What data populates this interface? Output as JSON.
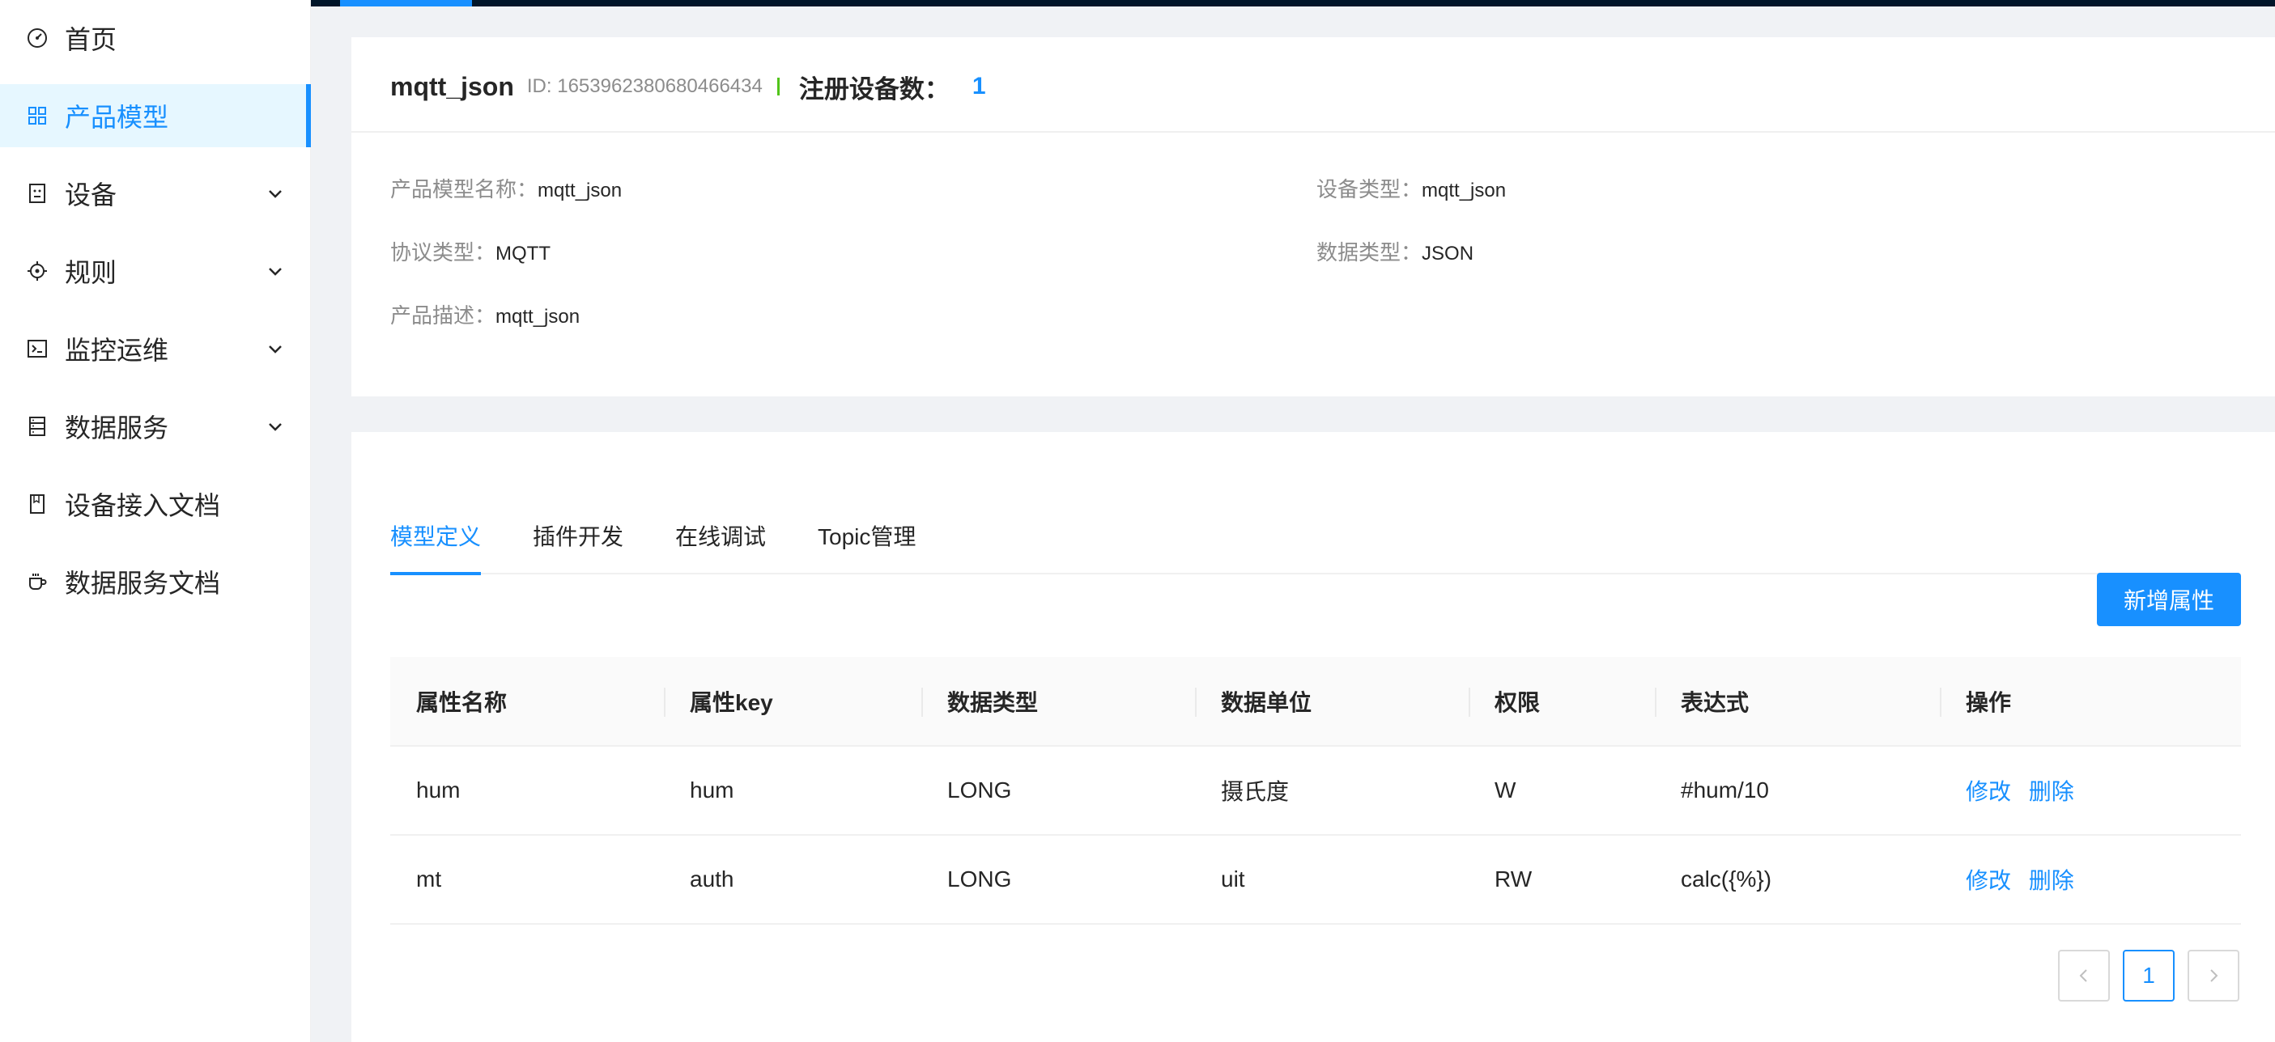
{
  "sidebar": {
    "items": [
      {
        "label": "首页",
        "icon": "dashboard-icon"
      },
      {
        "label": "产品模型",
        "icon": "appstore-icon"
      },
      {
        "label": "设备",
        "icon": "device-icon"
      },
      {
        "label": "规则",
        "icon": "aim-icon"
      },
      {
        "label": "监控运维",
        "icon": "terminal-icon"
      },
      {
        "label": "数据服务",
        "icon": "database-icon"
      },
      {
        "label": "设备接入文档",
        "icon": "book-icon"
      },
      {
        "label": "数据服务文档",
        "icon": "coffee-icon"
      }
    ]
  },
  "header": {
    "name": "mqtt_json",
    "id_text": "ID: 1653962380680466434",
    "reg_label": "注册设备数：",
    "reg_count": "1"
  },
  "details": {
    "model_name_label": "产品模型名称：",
    "model_name_value": "mqtt_json",
    "device_type_label": "设备类型：",
    "device_type_value": "mqtt_json",
    "protocol_label": "协议类型：",
    "protocol_value": "MQTT",
    "data_type_label": "数据类型：",
    "data_type_value": "JSON",
    "desc_label": "产品描述：",
    "desc_value": "mqtt_json"
  },
  "tabs": [
    "模型定义",
    "插件开发",
    "在线调试",
    "Topic管理"
  ],
  "add_button": "新增属性",
  "table": {
    "headers": [
      "属性名称",
      "属性key",
      "数据类型",
      "数据单位",
      "权限",
      "表达式",
      "操作"
    ],
    "rows": [
      [
        "hum",
        "hum",
        "LONG",
        "摄氏度",
        "W",
        "#hum/10"
      ],
      [
        "mt",
        "auth",
        "LONG",
        "uit",
        "RW",
        "calc({%})"
      ]
    ],
    "actions": {
      "edit": "修改",
      "delete": "删除"
    }
  },
  "pagination": {
    "current": "1"
  },
  "colors": {
    "primary": "#1890ff",
    "topbar": "#001529",
    "divider": "#52c41a"
  }
}
